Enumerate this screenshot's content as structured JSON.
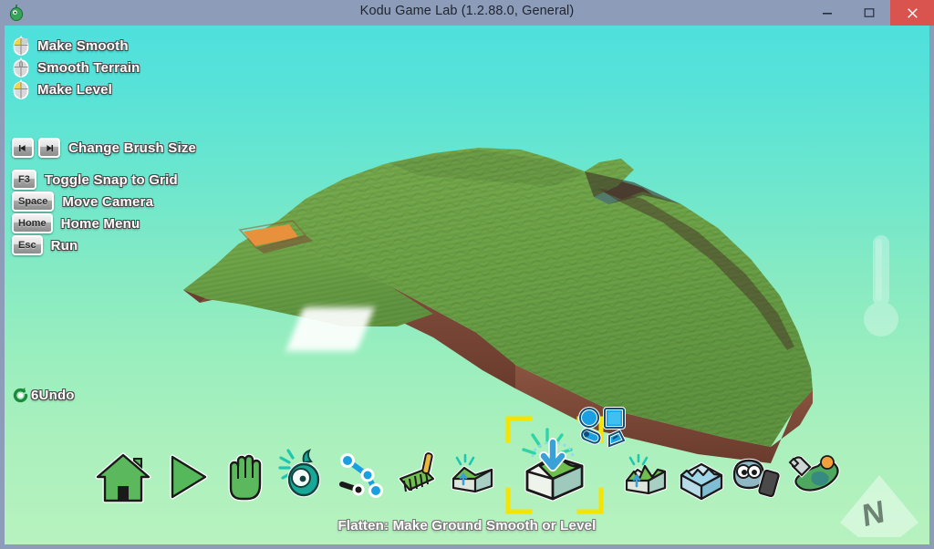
{
  "window": {
    "title": "Kodu Game Lab (1.2.88.0, General)",
    "app_icon": "kodu-icon",
    "controls": [
      {
        "name": "minimize-button",
        "icon": "minimize-icon",
        "label": "Minimize"
      },
      {
        "name": "maximize-button",
        "icon": "maximize-icon",
        "label": "Maximize"
      },
      {
        "name": "close-button",
        "icon": "close-icon",
        "label": "Close"
      }
    ],
    "close_color": "#d9534f",
    "chrome_color": "#8d9cb9"
  },
  "hud": {
    "mouse_bindings": [
      {
        "icon": "mouse-left-button-icon",
        "label": "Make Smooth"
      },
      {
        "icon": "mouse-middle-button-icon",
        "label": "Smooth Terrain"
      },
      {
        "icon": "mouse-left-button-icon",
        "label": "Make Level"
      }
    ],
    "key_bindings": [
      {
        "keys": [
          "left-arrow",
          "right-arrow"
        ],
        "label": "Change Brush Size"
      },
      {
        "keys": [
          "F3"
        ],
        "label": "Toggle Snap to Grid"
      },
      {
        "keys": [
          "Space"
        ],
        "label": "Move Camera"
      },
      {
        "keys": [
          "Home"
        ],
        "label": "Home Menu"
      },
      {
        "keys": [
          "Esc"
        ],
        "label": "Run"
      }
    ],
    "undo": {
      "icon": "undo-icon",
      "count": "6",
      "label": "Undo"
    }
  },
  "toolbar": {
    "tools": [
      {
        "name": "home-tool",
        "icon": "home-icon",
        "label": "Home Menu"
      },
      {
        "name": "play-tool",
        "icon": "play-icon",
        "label": "Play"
      },
      {
        "name": "hand-tool",
        "icon": "hand-icon",
        "label": "Move Camera"
      },
      {
        "name": "object-tool",
        "icon": "kodu-object-icon",
        "label": "Object Tool"
      },
      {
        "name": "path-tool",
        "icon": "path-node-icon",
        "label": "Path Tool"
      },
      {
        "name": "brush-tool",
        "icon": "paint-brush-icon",
        "label": "Paint Terrain"
      },
      {
        "name": "raise-lower-tool",
        "icon": "terrain-raise-icon",
        "label": "Up / Down"
      },
      {
        "name": "flatten-tool",
        "icon": "flatten-icon",
        "label": "Flatten",
        "selected": true
      },
      {
        "name": "spikey-hilly-tool",
        "icon": "terrain-spikey-icon",
        "label": "Spikey / Hilly"
      },
      {
        "name": "water-tool",
        "icon": "water-icon",
        "label": "Water"
      },
      {
        "name": "delete-tool",
        "icon": "eyeball-delete-icon",
        "label": "Delete Objects"
      },
      {
        "name": "world-tool",
        "icon": "wrench-world-icon",
        "label": "World Settings"
      }
    ],
    "brush_shapes": [
      {
        "name": "brush-shape-circle",
        "icon": "circle-icon",
        "selected": true
      },
      {
        "name": "brush-shape-square",
        "icon": "square-icon",
        "selected": false
      },
      {
        "name": "brush-shape-linear",
        "icon": "linear-brush-icon",
        "selected": false
      },
      {
        "name": "brush-shape-magic",
        "icon": "magic-brush-icon",
        "selected": false
      }
    ],
    "selection_color": "#f5e400"
  },
  "status": {
    "text": "Flatten: Make Ground Smooth or Level"
  },
  "viewport": {
    "zoom_slider": {
      "name": "zoom-slider",
      "icon": "thermometer-slider-icon"
    },
    "compass": {
      "name": "compass",
      "icon": "compass-icon",
      "direction": "N"
    },
    "brush_cursor": {
      "name": "ground-brush-cursor",
      "icon": "brush-cursor-icon"
    },
    "sky_top_color": "#4fe0dd",
    "sky_bottom_color": "#b7f2bf",
    "terrain_grass_color": "#6ea84a",
    "terrain_dirt_color": "#7a4a3a",
    "terrain_path_color": "#e8913c"
  }
}
